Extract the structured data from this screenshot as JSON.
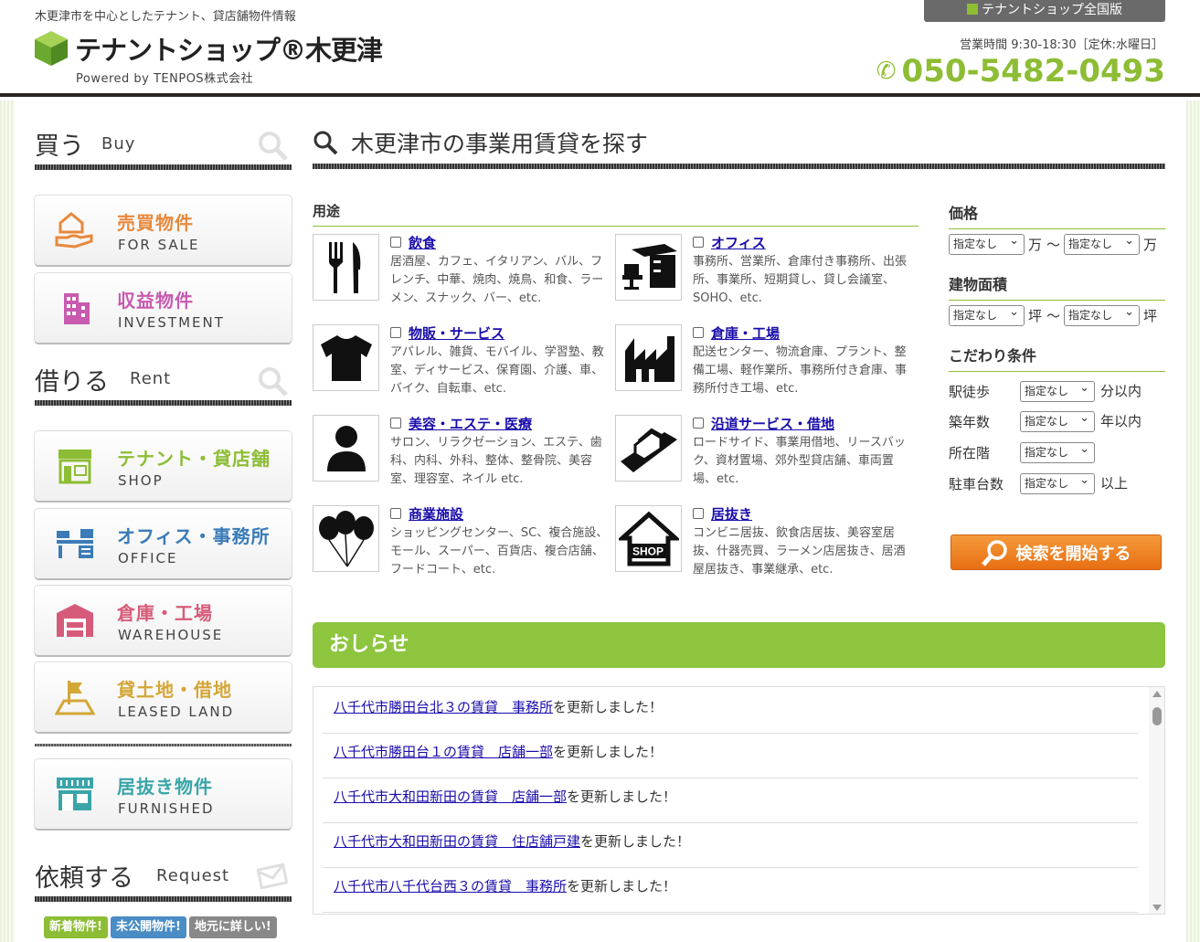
{
  "header": {
    "tagline": "木更津市を中心としたテナント、貸店舗物件情報",
    "logo_text": "テナントショップ®木更津",
    "powered": "Powered by  TENPOS株式会社",
    "national_link": "テナントショップ全国版",
    "hours": "営業時間 9:30-18:30［定休:水曜日］",
    "phone": "050-5482-0493"
  },
  "sidebar": {
    "buy": {
      "jp": "買う",
      "en": "Buy"
    },
    "rent": {
      "jp": "借りる",
      "en": "Rent"
    },
    "request": {
      "jp": "依頼する",
      "en": "Request"
    },
    "buy_items": [
      {
        "jp": "売買物件",
        "en": "FOR SALE",
        "color": "#e8883a"
      },
      {
        "jp": "収益物件",
        "en": "INVESTMENT",
        "color": "#c85ab0"
      }
    ],
    "rent_items": [
      {
        "jp": "テナント・貸店舗",
        "en": "SHOP",
        "color": "#8dbd34"
      },
      {
        "jp": "オフィス・事務所",
        "en": "OFFICE",
        "color": "#3a7bb8"
      },
      {
        "jp": "倉庫・工場",
        "en": "WAREHOUSE",
        "color": "#d65b7a"
      },
      {
        "jp": "貸土地・借地",
        "en": "LEASED LAND",
        "color": "#d4a636"
      }
    ],
    "furnished": {
      "jp": "居抜き物件",
      "en": "FURNISHED",
      "color": "#3aa5a8"
    },
    "badges": [
      {
        "text": "新着物件!",
        "color": "#8dbd34"
      },
      {
        "text": "未公開物件!",
        "color": "#4a8cc4"
      },
      {
        "text": "地元に詳しい!",
        "color": "#888888"
      }
    ]
  },
  "main": {
    "title": "木更津市の事業用賃貸を探す",
    "usage_label": "用途",
    "categories": [
      {
        "name": "飲食",
        "desc": "居酒屋、カフェ、イタリアン、バル、フレンチ、中華、焼肉、焼鳥、和食、ラーメン、スナック、バー、etc.",
        "icon": "fork-knife-icon"
      },
      {
        "name": "オフィス",
        "desc": "事務所、営業所、倉庫付き事務所、出張所、事業所、短期貸し、貸し会議室、SOHO、etc.",
        "icon": "office-desk-icon"
      },
      {
        "name": "物販・サービス",
        "desc": "アパレル、雑貨、モバイル、学習塾、教室、ディサービス、保育園、介護、車、バイク、自転車、etc.",
        "icon": "tshirt-icon"
      },
      {
        "name": "倉庫・工場",
        "desc": "配送センター、物流倉庫、プラント、整備工場、軽作業所、事務所付き倉庫、事務所付き工場、etc.",
        "icon": "factory-icon"
      },
      {
        "name": "美容・エステ・医療",
        "desc": "サロン、リラクゼーション、エステ、歯科、内科、外科、整体、整骨院、美容室、理容室、ネイル etc.",
        "icon": "person-icon"
      },
      {
        "name": "沿道サービス・借地",
        "desc": "ロードサイド、事業用借地、リースバック、資材置場、郊外型貸店舗、車両置場、etc.",
        "icon": "roadside-icon"
      },
      {
        "name": "商業施設",
        "desc": "ショッピングセンター、SC、複合施設、モール、スーパー、百貨店、複合店舗、フードコート、etc.",
        "icon": "balloons-icon"
      },
      {
        "name": "居抜き",
        "desc": "コンビニ居抜、飲食店居抜、美容室居抜、什器売買、ラーメン店居抜き、居酒屋居抜き、事業継承、etc.",
        "icon": "shop-house-icon"
      }
    ],
    "news_head": "おしらせ",
    "news": [
      {
        "link": "八千代市勝田台北３の賃貸　事務所",
        "suffix": "を更新しました！"
      },
      {
        "link": "八千代市勝田台１の賃貸　店舗一部",
        "suffix": "を更新しました！"
      },
      {
        "link": "八千代市大和田新田の賃貸　店舗一部",
        "suffix": "を更新しました！"
      },
      {
        "link": "八千代市大和田新田の賃貸　住店舗戸建",
        "suffix": "を更新しました！"
      },
      {
        "link": "八千代市八千代台西３の賃貸　事務所",
        "suffix": "を更新しました！"
      }
    ]
  },
  "filters": {
    "price": "価格",
    "area": "建物面積",
    "conditions": "こだわり条件",
    "select_default": "指定なし",
    "man": "万",
    "tsubo": "坪",
    "tilde": "〜",
    "rows": [
      {
        "label": "駅徒歩",
        "unit": "分以内"
      },
      {
        "label": "築年数",
        "unit": "年以内"
      },
      {
        "label": "所在階",
        "unit": ""
      },
      {
        "label": "駐車台数",
        "unit": "以上"
      }
    ],
    "search_button": "検索を開始する"
  }
}
